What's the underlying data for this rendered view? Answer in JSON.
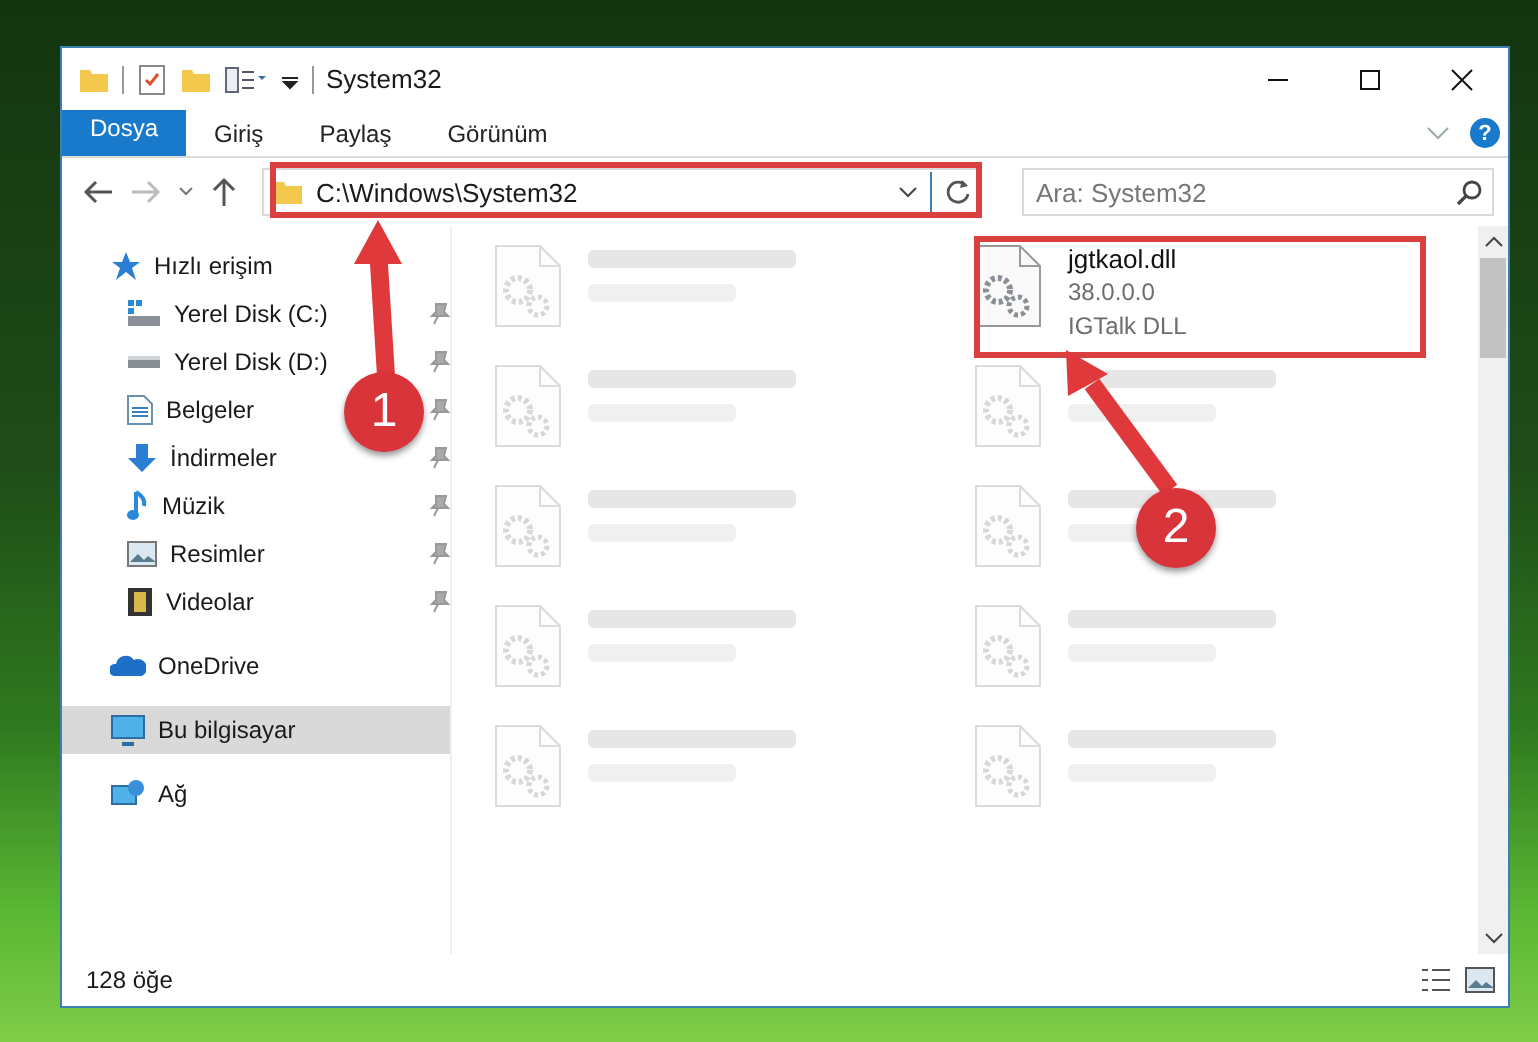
{
  "window": {
    "title": "System32"
  },
  "ribbon": {
    "tabs": [
      {
        "label": "Dosya",
        "kind": "file",
        "selected": false
      },
      {
        "label": "Giriş",
        "kind": "tab",
        "selected": false
      },
      {
        "label": "Paylaş",
        "kind": "tab",
        "selected": false
      },
      {
        "label": "Görünüm",
        "kind": "tab",
        "selected": false
      }
    ],
    "help": "?"
  },
  "address": {
    "path": "C:\\Windows\\System32"
  },
  "search": {
    "placeholder": "Ara: System32"
  },
  "sidebar": {
    "items": [
      {
        "label": "Hızlı erişim",
        "selected": false,
        "children": [
          {
            "label": "Yerel Disk (C:)",
            "pinned": true,
            "selected": false
          },
          {
            "label": "Yerel Disk (D:)",
            "pinned": true,
            "selected": false
          },
          {
            "label": "Belgeler",
            "pinned": true,
            "selected": false
          },
          {
            "label": "İndirmeler",
            "pinned": true,
            "selected": false
          },
          {
            "label": "Müzik",
            "pinned": true,
            "selected": false
          },
          {
            "label": "Resimler",
            "pinned": true,
            "selected": false
          },
          {
            "label": "Videolar",
            "pinned": true,
            "selected": false
          }
        ]
      },
      {
        "label": "OneDrive",
        "selected": false
      },
      {
        "label": "Bu bilgisayar",
        "selected": true
      },
      {
        "label": "Ağ",
        "selected": false
      }
    ]
  },
  "files": [
    {
      "blurred": true
    },
    {
      "name": "jgtkaol.dll",
      "details": [
        "38.0.0.0",
        "IGTalk DLL"
      ],
      "blurred": false
    },
    {
      "blurred": true
    },
    {
      "blurred": true
    },
    {
      "blurred": true
    },
    {
      "blurred": true
    },
    {
      "blurred": true
    },
    {
      "blurred": true
    },
    {
      "blurred": true
    },
    {
      "blurred": true
    }
  ],
  "status_bar": {
    "count": "128 öğe"
  },
  "annotations": [
    {
      "number": "1"
    },
    {
      "number": "2"
    }
  ]
}
